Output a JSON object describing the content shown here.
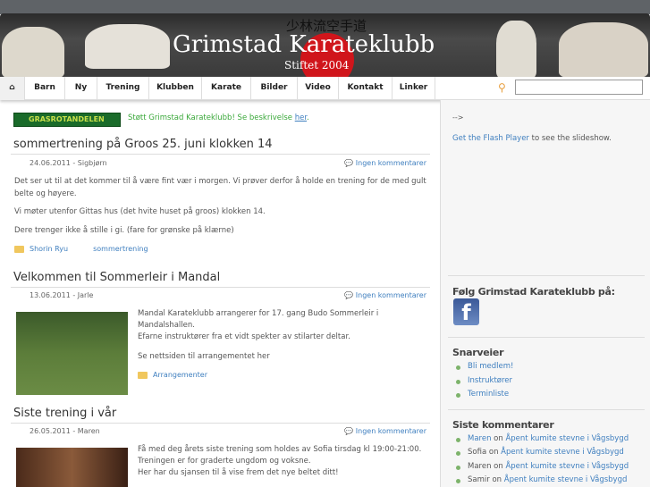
{
  "header": {
    "kanji": "少林流空手道",
    "title": "Grimstad Karateklubb",
    "subtitle": "Stiftet 2004"
  },
  "nav": {
    "items": [
      "Barn",
      "Ny",
      "Trening",
      "Klubben",
      "Karate",
      "Bilder",
      "Video",
      "Kontakt",
      "Linker"
    ],
    "search_value": ""
  },
  "grasrot": {
    "logo": "GRASROTANDELEN",
    "text": "Støtt Grimstad Karateklubb! Se beskrivelse ",
    "link": "her",
    "end": "."
  },
  "posts": [
    {
      "title": "sommertrening på Groos 25. juni klokken 14",
      "meta": "24.06.2011 - Sigbjørn",
      "comments": "Ingen kommentarer",
      "paragraphs": [
        "Det ser ut til at det kommer til å være fint vær i morgen. Vi prøver derfor å holde en trening for de med gult belte og høyere.",
        "Vi møter utenfor Gittas hus (det hvite huset på groos) klokken 14.",
        "Dere trenger ikke å stille i gi. (fare for grønske på klærne)"
      ],
      "category": "Shorin Ryu",
      "tag": "sommertrening"
    },
    {
      "title": "Velkommen til Sommerleir i Mandal",
      "meta": "13.06.2011 - Jarle",
      "comments": "Ingen kommentarer",
      "line1": "Mandal Karateklubb arrangerer for 17. gang Budo Sommerleir i Mandalshallen.",
      "line2": "Efarne instruktører fra et vidt spekter av stilarter deltar.",
      "link": "Se nettsiden til arrangementet her",
      "category": "Arrangementer"
    },
    {
      "title": "Siste trening i vår",
      "meta": "26.05.2011 - Maren",
      "comments": "Ingen kommentarer",
      "lines": [
        "Få med deg årets siste trening som holdes av Sofia tirsdag kl 19:00-21:00.",
        "Treningen er for graderte ungdom og voksne.",
        "Her har du sjansen til å vise frem det nye beltet ditt!"
      ]
    }
  ],
  "sidebar": {
    "comment_marker": "-->",
    "flash_link": "Get the Flash Player",
    "flash_text": " to see the slideshow.",
    "follow_title": "Følg Grimstad Karateklubb på:",
    "shortcuts_title": "Snarveier",
    "shortcuts": [
      "Bli medlem!",
      "Instruktører",
      "Terminliste"
    ],
    "recent_title": "Siste kommentarer",
    "on": "on",
    "recent": [
      {
        "author": "Maren",
        "post": "Åpent kumite stevne i Vågsbygd"
      },
      {
        "author": "Sofia",
        "post": "Åpent kumite stevne i Vågsbygd"
      },
      {
        "author": "Maren",
        "post": "Åpent kumite stevne i Vågsbygd"
      },
      {
        "author": "Samir",
        "post": "Åpent kumite stevne i Vågsbygd"
      }
    ]
  }
}
